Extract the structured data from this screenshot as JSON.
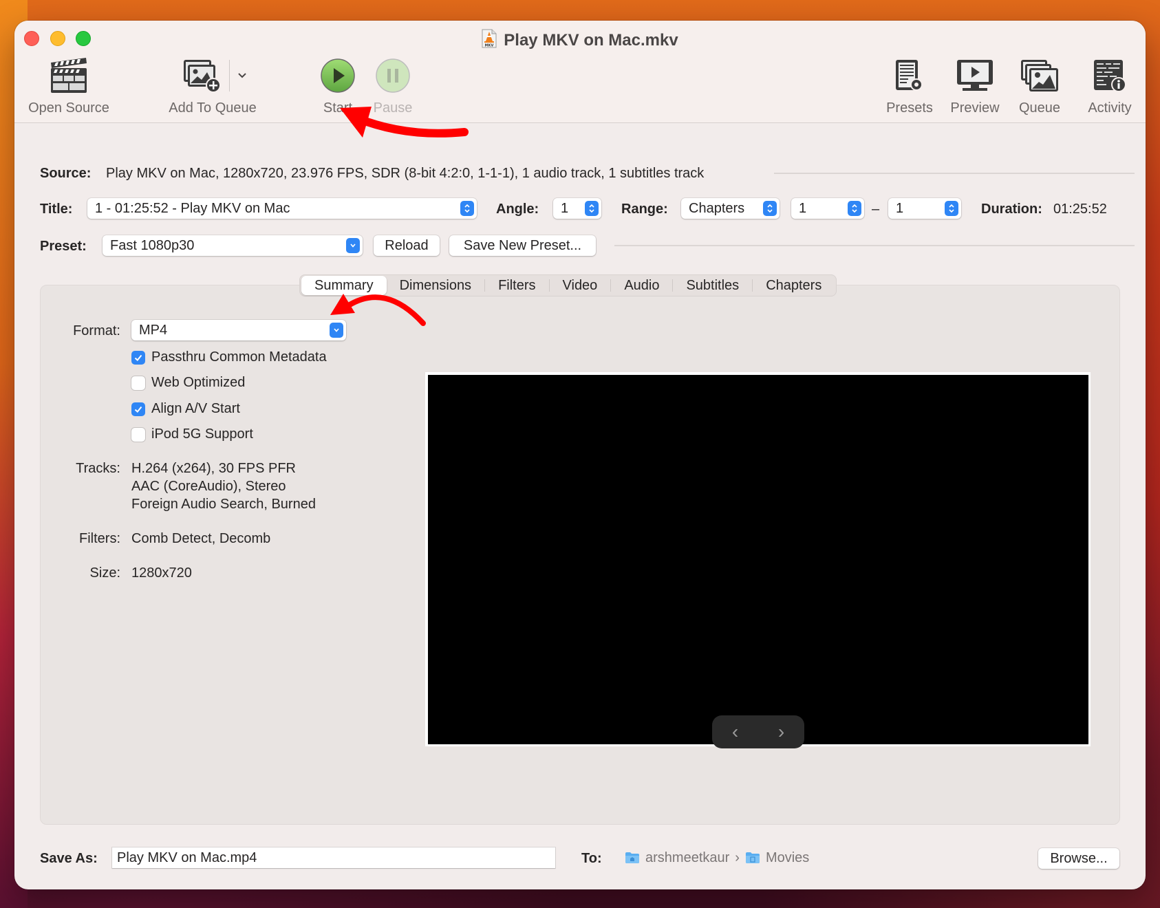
{
  "window": {
    "title": "Play MKV on Mac.mkv",
    "title_icon": "mkv-file-icon"
  },
  "toolbar": {
    "items": [
      {
        "label": "Open Source",
        "icon": "clapperboard-icon",
        "enabled": true
      },
      {
        "label": "Add To Queue",
        "icon": "add-to-queue-icon",
        "enabled": true
      },
      {
        "label": "Start",
        "icon": "play-icon",
        "enabled": true
      },
      {
        "label": "Pause",
        "icon": "pause-icon",
        "enabled": false
      },
      {
        "label": "Presets",
        "icon": "presets-icon",
        "enabled": true
      },
      {
        "label": "Preview",
        "icon": "preview-monitor-icon",
        "enabled": true
      },
      {
        "label": "Queue",
        "icon": "queue-images-icon",
        "enabled": true
      },
      {
        "label": "Activity",
        "icon": "activity-log-icon",
        "enabled": true
      }
    ]
  },
  "source": {
    "label": "Source:",
    "value": "Play MKV on Mac, 1280x720, 23.976 FPS, SDR (8-bit 4:2:0, 1-1-1), 1 audio track, 1 subtitles track"
  },
  "title_row": {
    "title_label": "Title:",
    "title_value": "1 - 01:25:52 - Play MKV on Mac",
    "angle_label": "Angle:",
    "angle_value": "1",
    "range_label": "Range:",
    "range_type": "Chapters",
    "range_start": "1",
    "range_dash": "–",
    "range_end": "1",
    "duration_label": "Duration:",
    "duration_value": "01:25:52"
  },
  "preset_row": {
    "label": "Preset:",
    "value": "Fast 1080p30",
    "reload_label": "Reload",
    "save_new_label": "Save New Preset..."
  },
  "tabs": [
    {
      "label": "Summary",
      "active": true
    },
    {
      "label": "Dimensions",
      "active": false
    },
    {
      "label": "Filters",
      "active": false
    },
    {
      "label": "Video",
      "active": false
    },
    {
      "label": "Audio",
      "active": false
    },
    {
      "label": "Subtitles",
      "active": false
    },
    {
      "label": "Chapters",
      "active": false
    }
  ],
  "summary": {
    "format_label": "Format:",
    "format_value": "MP4",
    "options": [
      {
        "label": "Passthru Common Metadata",
        "checked": true
      },
      {
        "label": "Web Optimized",
        "checked": false
      },
      {
        "label": "Align A/V Start",
        "checked": true
      },
      {
        "label": "iPod 5G Support",
        "checked": false
      }
    ],
    "tracks_label": "Tracks:",
    "tracks": [
      "H.264 (x264), 30 FPS PFR",
      "AAC (CoreAudio), Stereo",
      "Foreign Audio Search, Burned"
    ],
    "filters_label": "Filters:",
    "filters_value": "Comb Detect, Decomb",
    "size_label": "Size:",
    "size_value": "1280x720"
  },
  "preview": {
    "prev_glyph": "‹",
    "next_glyph": "›"
  },
  "save": {
    "label": "Save As:",
    "filename": "Play MKV on Mac.mp4",
    "to_label": "To:",
    "path": [
      "arshmeetkaur",
      "Movies"
    ],
    "path_separator": "›",
    "browse_label": "Browse..."
  },
  "colors": {
    "accent": "#2f86f5",
    "annotation_arrow": "#ff0000",
    "start_green": "#6cbf4a"
  }
}
